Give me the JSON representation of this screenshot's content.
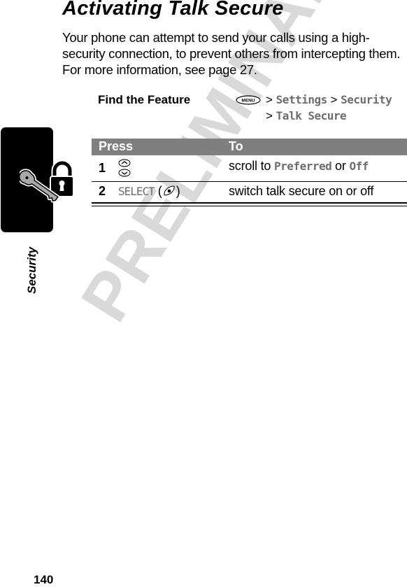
{
  "page": {
    "title": "Activating Talk Secure",
    "intro": "Your phone can attempt to send your calls using a high-security connection, to prevent others from intercepting them. For more information, see page 27.",
    "watermark": "PRELIMINARY",
    "section_tab_label": "Security",
    "page_number": "140"
  },
  "find_feature": {
    "label": "Find the Feature",
    "menu_key_label": "MENU",
    "separator": ">",
    "path": [
      "Settings",
      "Security",
      "Talk Secure"
    ]
  },
  "table": {
    "headers": [
      "Press",
      "To"
    ],
    "rows": [
      {
        "step": "1",
        "press_icon": "scroll-up-down-icon",
        "to_prefix": "scroll to",
        "to_option_1": "Preferred",
        "to_joiner": "or",
        "to_option_2": "Off"
      },
      {
        "step": "2",
        "press_key": "SELECT",
        "press_icon": "select-key-icon",
        "to": "switch talk secure on or off"
      }
    ]
  },
  "icons": {
    "section": "lock-and-key-icon",
    "menu": "menu-key-icon"
  }
}
